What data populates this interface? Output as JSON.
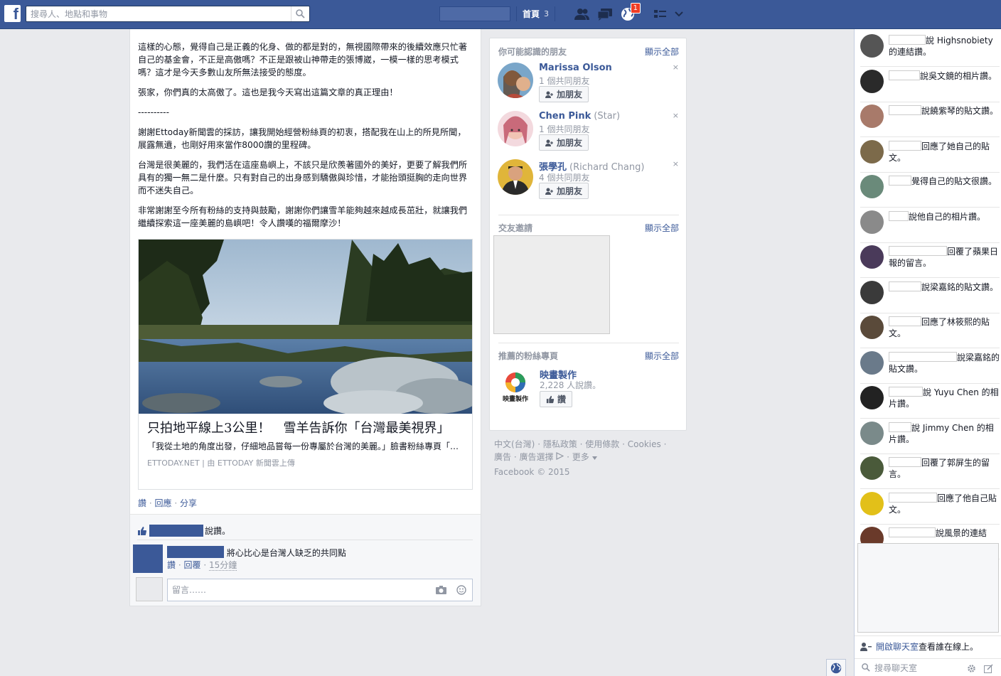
{
  "topbar": {
    "search_placeholder": "搜尋人、地點和事物",
    "home_label": "首頁",
    "home_count": "3",
    "notification_count": "1"
  },
  "post": {
    "cut_line": "這樣的心態，覺得自己是正義的化身……",
    "paragraphs": [
      "這樣的心態，覺得自己是正義的化身、做的都是對的，無視國際帶來的後續效應只忙著自己的基金會，不正是高傲嗎？不正是跟被山神帶走的張博崴，一模一樣的思考模式嗎？這才是今天多數山友所無法接受的態度。",
      "張家，你們真的太高傲了。這也是我今天寫出這篇文章的真正理由！",
      "----------",
      "謝謝Ettoday新聞雲的採訪，讓我開始經營粉絲頁的初衷，搭配我在山上的所見所聞，展露無遺，也剛好用來當作8000讚的里程碑。",
      "台灣是很美麗的，我們活在這座島嶼上，不該只是欣羨著國外的美好，更要了解我們所具有的獨一無二是什麼。只有對自己的出身感到驕傲與珍惜，才能抬頭挺胸的走向世界而不迷失自己。",
      "非常謝謝至今所有粉絲的支持與鼓勵，謝謝你們讓雪羊能夠越來越成長茁壯，就讓我們繼續探索這一座美麗的島嶼吧！令人讚嘆的福爾摩沙！"
    ],
    "attachment": {
      "title": "只拍地平線上3公里！　雪羊告訴你「台灣最美視界」",
      "description": "「我從土地的角度出發，仔細地品嘗每一份專屬於台灣的美麗。」臉書粉絲專頁「雪羊」的版主",
      "source": "ETTODAY.NET | 由 ETTODAY 新聞雲上傳"
    },
    "actions": {
      "like": "讚",
      "comment": "回應",
      "share": "分享",
      "sep": "·"
    },
    "likes_text": "說讚。",
    "comment": {
      "text": "將心比心是台灣人缺乏的共同點",
      "like": "讚",
      "reply": "回覆",
      "time": "15分鐘",
      "sep": "·"
    },
    "reply_placeholder": "留言……"
  },
  "sidebar": {
    "pymk": {
      "title": "你可能認識的朋友",
      "show_all": "顯示全部",
      "people": [
        {
          "name": "Marissa Olson",
          "alt": "",
          "mutual": "1 個共同朋友",
          "button": "加朋友"
        },
        {
          "name": "Chen Pink",
          "alt": "(Star)",
          "mutual": "1 個共同朋友",
          "button": "加朋友"
        },
        {
          "name": "張學孔",
          "alt": "(Richard Chang)",
          "mutual": "4 個共同朋友",
          "button": "加朋友"
        }
      ],
      "close": "×"
    },
    "invites": {
      "title": "交友邀請",
      "show_all": "顯示全部"
    },
    "pages": {
      "title": "推薦的粉絲專頁",
      "show_all": "顯示全部",
      "name": "映畫製作",
      "likes": "2,228 人說讚。",
      "button": "讚",
      "logo_text": "映畫製作"
    }
  },
  "footer": {
    "links": [
      "中文(台灣)",
      "隱私政策",
      "使用條款",
      "Cookies",
      "廣告",
      "廣告選擇",
      "更多"
    ],
    "copyright": "Facebook © 2015"
  },
  "ticker": {
    "items": [
      {
        "text": "說 Highsnobiety 的連結讚。"
      },
      {
        "text": "說吳文鏡的相片讚。"
      },
      {
        "text": "說饒紫琴的貼文讚。"
      },
      {
        "text": "回應了她自己的貼文。"
      },
      {
        "text": "覺得自己的貼文很讚。"
      },
      {
        "text": "說他自己的相片讚。"
      },
      {
        "text": "回覆了蘋果日報的留言。"
      },
      {
        "text": "說梁嘉銘的貼文讚。"
      },
      {
        "text": "回應了林筱熙的貼文。"
      },
      {
        "text": "說梁嘉銘的貼文讚。"
      },
      {
        "text": "說 Yuyu Chen 的相片讚。"
      },
      {
        "text": "說 Jimmy Chen 的相片讚。"
      },
      {
        "text": "回覆了郭屏生的留言。"
      },
      {
        "text": "回應了他自己貼文。"
      },
      {
        "text": "說風景的連結"
      }
    ],
    "chat_link": "開啟聊天室",
    "chat_rest": "查看誰在線上。",
    "chat_search": "搜尋聊天室"
  },
  "colors": {
    "brand": "#3b5998",
    "link": "#3b5998",
    "muted": "#9197a3"
  }
}
